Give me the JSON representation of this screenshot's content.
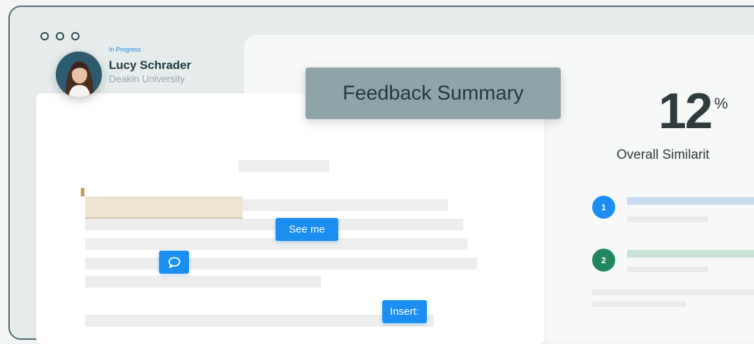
{
  "window": {
    "controls": [
      "close",
      "minimize",
      "maximize"
    ]
  },
  "student": {
    "status": "In Progress",
    "name": "Lucy Schrader",
    "institution": "Deakin University",
    "avatar_icon": "student-avatar"
  },
  "feedback": {
    "title": "Feedback Summary"
  },
  "document": {
    "buttons": {
      "see_me": "See me",
      "insert": "Insert:"
    },
    "comment_icon": "comment-bubble-icon"
  },
  "similarity": {
    "value": "12",
    "percent_sign": "%",
    "label": "Overall Similarit",
    "sources": [
      {
        "number": "1",
        "color": "#1b8ef2"
      },
      {
        "number": "2",
        "color": "#23875e"
      }
    ]
  },
  "colors": {
    "accent": "#1b8ef2",
    "source_green": "#23875e",
    "window_border": "#4f6870",
    "tag_background": "#8fa4a8"
  }
}
